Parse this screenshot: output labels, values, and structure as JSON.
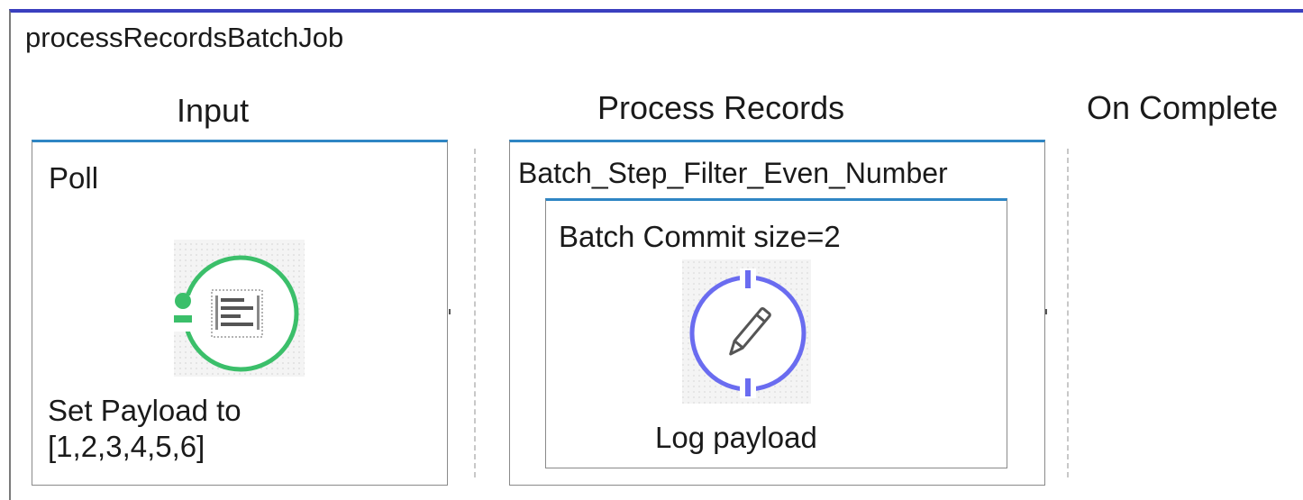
{
  "job": {
    "title": "processRecordsBatchJob"
  },
  "sections": {
    "input": {
      "title": "Input",
      "source_label": "Poll",
      "component": {
        "icon": "set-payload-icon",
        "label_line1": "Set Payload to",
        "label_line2": "[1,2,3,4,5,6]"
      }
    },
    "process": {
      "title": "Process Records",
      "step_label": "Batch_Step_Filter_Even_Number",
      "commit_label": "Batch Commit size=2",
      "component": {
        "icon": "logger-icon",
        "label": "Log payload"
      }
    },
    "on_complete": {
      "title": "On Complete"
    }
  },
  "colors": {
    "header_border": "#3a3fbf",
    "box_accent": "#2f86c4",
    "set_payload_green": "#3bbf6a",
    "logger_blue": "#6a6cf0"
  }
}
